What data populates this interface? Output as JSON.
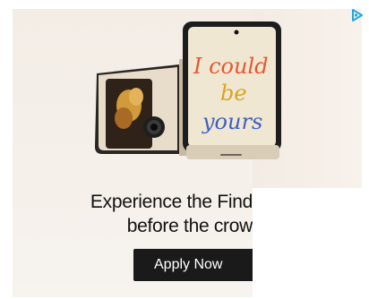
{
  "ad": {
    "headline_line1": "Experience the Find",
    "headline_line2": "before the crow",
    "cta_label": "Apply Now",
    "screen_text_line1": "I could",
    "screen_text_line2": "be",
    "screen_text_line3": "yours"
  },
  "icons": {
    "adchoices": "adchoices-icon"
  },
  "colors": {
    "cta_background": "#1a1a1a",
    "cta_text": "#ffffff",
    "headline": "#111111",
    "adchoices": "#1fa9e0"
  }
}
